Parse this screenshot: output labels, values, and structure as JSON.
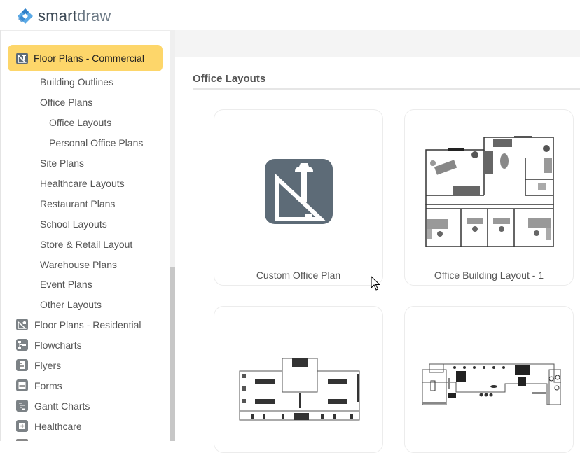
{
  "app": {
    "brand_bold": "smart",
    "brand_light": "draw"
  },
  "sidebar": {
    "selected_category": {
      "label": "Floor Plans - Commercial",
      "icon": "floor-plan-commercial-icon"
    },
    "subitems": [
      {
        "label": "Building Outlines",
        "level": 1
      },
      {
        "label": "Office Plans",
        "level": 1
      },
      {
        "label": "Office Layouts",
        "level": 2
      },
      {
        "label": "Personal Office Plans",
        "level": 2
      },
      {
        "label": "Site Plans",
        "level": 1
      },
      {
        "label": "Healthcare Layouts",
        "level": 1
      },
      {
        "label": "Restaurant Plans",
        "level": 1
      },
      {
        "label": "School Layouts",
        "level": 1
      },
      {
        "label": "Store & Retail Layout",
        "level": 1
      },
      {
        "label": "Warehouse Plans",
        "level": 1
      },
      {
        "label": "Event Plans",
        "level": 1
      },
      {
        "label": "Other Layouts",
        "level": 1
      }
    ],
    "categories": [
      {
        "label": "Floor Plans - Residential",
        "icon": "floor-plan-residential-icon"
      },
      {
        "label": "Flowcharts",
        "icon": "flowchart-icon"
      },
      {
        "label": "Flyers",
        "icon": "flyer-icon"
      },
      {
        "label": "Forms",
        "icon": "form-icon"
      },
      {
        "label": "Gantt Charts",
        "icon": "gantt-chart-icon"
      },
      {
        "label": "Healthcare",
        "icon": "healthcare-icon"
      }
    ]
  },
  "main": {
    "section_title": "Office Layouts",
    "templates": [
      {
        "caption": "Custom Office Plan",
        "thumbnail": "custom-plan-icon"
      },
      {
        "caption": "Office Building Layout - 1",
        "thumbnail": "floor-plan-thumbnail"
      },
      {
        "caption": "",
        "thumbnail": "floor-plan-thumbnail"
      },
      {
        "caption": "",
        "thumbnail": "floor-plan-thumbnail"
      }
    ]
  },
  "colors": {
    "selected_bg": "#fdd66a",
    "icon_slate": "#5d6b77",
    "brand_blue": "#4a90d9"
  }
}
